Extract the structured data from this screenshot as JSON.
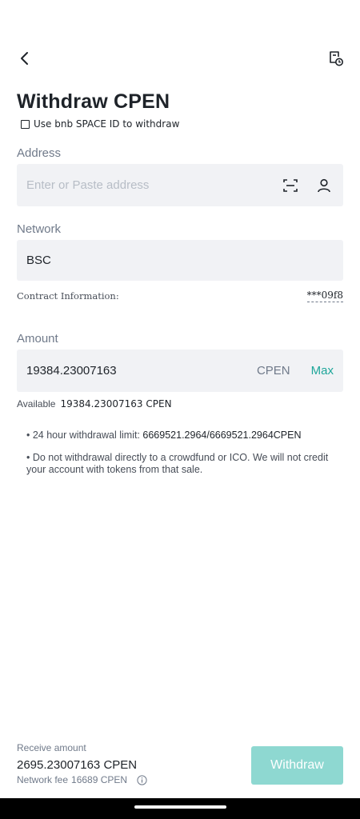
{
  "header": {
    "title": "Withdraw CPEN",
    "back_icon": "chevron-left-icon",
    "history_icon": "document-clock-icon"
  },
  "space_id": {
    "label": "Use bnb SPACE ID to withdraw",
    "checked": false
  },
  "address": {
    "label": "Address",
    "placeholder": "Enter or Paste address",
    "value": "",
    "scan_icon": "scan-icon",
    "contact_icon": "person-icon"
  },
  "network": {
    "label": "Network",
    "value": "BSC"
  },
  "contract": {
    "label": "Contract Information:",
    "value": "***09f8"
  },
  "amount": {
    "label": "Amount",
    "value": "19384.23007163",
    "unit": "CPEN",
    "max_label": "Max"
  },
  "available": {
    "label": "Available",
    "value": "19384.23007163 CPEN"
  },
  "notes": {
    "limit_prefix": "• 24 hour withdrawal limit: ",
    "limit_value": "6669521.2964/6669521.2964CPEN",
    "warning": "• Do not withdrawal directly to a crowdfund or ICO. We will not credit your account with tokens from that sale."
  },
  "footer": {
    "receive_label": "Receive amount",
    "receive_value": "2695.23007163 CPEN",
    "fee_label": "Network fee",
    "fee_value": "16689 CPEN",
    "info_icon": "info-icon",
    "withdraw_label": "Withdraw"
  },
  "colors": {
    "accent": "#1ea69a",
    "button_disabled": "#8ed8d1",
    "field_bg": "#f1f2f5",
    "text_primary": "#1e2329",
    "text_secondary": "#707a8a"
  }
}
